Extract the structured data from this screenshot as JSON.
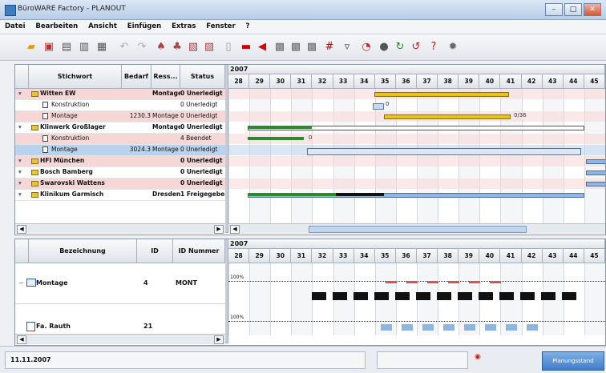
{
  "window": {
    "title": "BüroWARE Factory - PLANOUT"
  },
  "menu": [
    "Datei",
    "Bearbeiten",
    "Ansicht",
    "Einfügen",
    "Extras",
    "Fenster",
    "?"
  ],
  "toolbar_icons": [
    "open-icon",
    "save-icon",
    "print-preview-icon",
    "document-icon",
    "print-icon",
    "undo-icon",
    "redo-icon",
    "binoculars-icon",
    "binoculars-next-icon",
    "table-icon",
    "filter-table-icon",
    "page-icon",
    "minus-icon",
    "red-arrow-icon",
    "chart-icon",
    "chart-edit-icon",
    "chart-add-icon",
    "grid-icon",
    "funnel-icon",
    "clock-icon",
    "link-icon",
    "refresh-green-icon",
    "refresh-red-icon",
    "help-icon",
    "settings-icon"
  ],
  "upper": {
    "columns": [
      "Stichwort",
      "Bedarf",
      "Ress...",
      "Status"
    ],
    "year": "2007",
    "weeks": [
      "28",
      "29",
      "30",
      "31",
      "32",
      "33",
      "34",
      "35",
      "36",
      "37",
      "38",
      "39",
      "40",
      "41",
      "42",
      "43",
      "44",
      "45"
    ],
    "rows": [
      {
        "label": "Witten EW",
        "bedarf": "",
        "ress": "Montage",
        "status": "0 Unerledigt",
        "level": 0,
        "bold": true,
        "pink": true
      },
      {
        "label": "Konstruktion",
        "bedarf": "",
        "ress": "",
        "status": "0 Unerledigt",
        "level": 1,
        "bold": false,
        "pink": false
      },
      {
        "label": "Montage",
        "bedarf": "1230.3",
        "ress": "Montage",
        "status": "0 Unerledigt",
        "level": 1,
        "bold": false,
        "pink": true
      },
      {
        "label": "Klinwerk Großlager",
        "bedarf": "",
        "ress": "Montage",
        "status": "0 Unerledigt",
        "level": 0,
        "bold": true,
        "pink": false
      },
      {
        "label": "Konstruktion",
        "bedarf": "",
        "ress": "",
        "status": "4 Beendet",
        "level": 1,
        "bold": false,
        "pink": true
      },
      {
        "label": "Montage",
        "bedarf": "3024.3",
        "ress": "Montage",
        "status": "0 Unerledigt",
        "level": 1,
        "bold": false,
        "pink": false,
        "selected": true
      },
      {
        "label": "HFI München",
        "bedarf": "",
        "ress": "",
        "status": "0 Unerledigt",
        "level": 0,
        "bold": true,
        "pink": true
      },
      {
        "label": "Bosch Bamberg",
        "bedarf": "",
        "ress": "",
        "status": "0 Unerledigt",
        "level": 0,
        "bold": true,
        "pink": false
      },
      {
        "label": "Swarovski Wattens",
        "bedarf": "",
        "ress": "",
        "status": "0 Unerledigt",
        "level": 0,
        "bold": true,
        "pink": true
      },
      {
        "label": "Klinikum Garmisch",
        "bedarf": "",
        "ress": "Dresden",
        "status": "1 Freigegeben",
        "level": 0,
        "bold": true,
        "pink": false
      }
    ],
    "annotations": {
      "r1": "0",
      "r4": "0",
      "r2": "0/36"
    }
  },
  "lower": {
    "columns": [
      "Bezeichnung",
      "ID",
      "ID Nummer"
    ],
    "year": "2007",
    "weeks": [
      "28",
      "29",
      "30",
      "31",
      "32",
      "33",
      "34",
      "35",
      "36",
      "37",
      "38",
      "39",
      "40",
      "41",
      "42",
      "43",
      "44",
      "45"
    ],
    "rows": [
      {
        "label": "Montage",
        "id": "4",
        "idnr": "MONT",
        "load": "100%"
      },
      {
        "label": "Fa. Rauth",
        "id": "21",
        "idnr": "",
        "load": "100%"
      }
    ]
  },
  "status": {
    "date": "11.11.2007",
    "button": "Planungsstand"
  },
  "colors": {
    "pinkRow": "#f7d6d6",
    "selectedRow": "#b9d3ef",
    "yellowBar": "#e6c21c",
    "greenBar": "#2b8a2b",
    "blueBar": "#8fb6e0",
    "redBar": "#e05050"
  }
}
